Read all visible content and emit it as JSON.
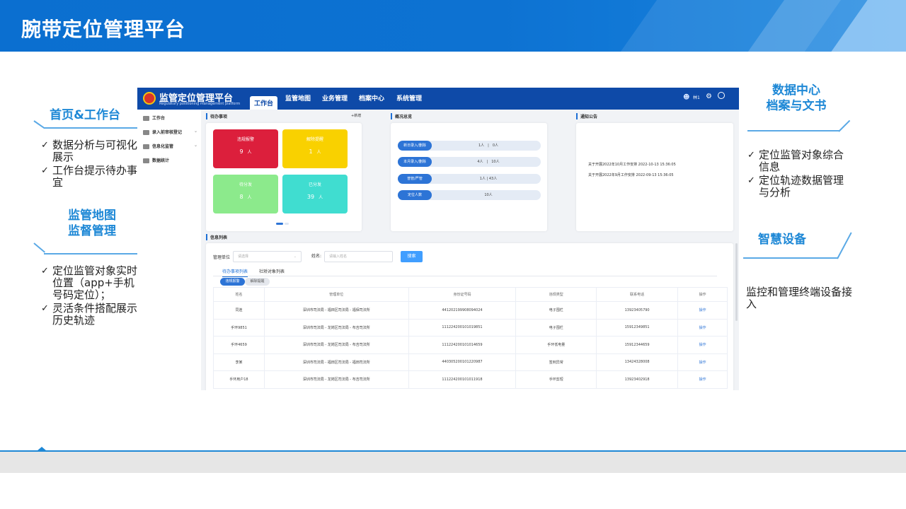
{
  "slide": {
    "title": "腕带定位管理平台"
  },
  "captions": {
    "home": {
      "title": "首页&工作台",
      "items": [
        "数据分析与可视化展示",
        "工作台提示待办事宜"
      ]
    },
    "map": {
      "title_line1": "监管地图",
      "title_line2": "监督管理",
      "items": [
        "定位监管对象实时位置（app+手机号码定位）；",
        "灵活条件搭配展示历史轨迹"
      ]
    },
    "data": {
      "title_line1": "数据中心",
      "title_line2": "档案与文书",
      "items": [
        "定位监管对象综合信息",
        "定位轨迹数据管理与分析"
      ]
    },
    "device": {
      "title": "智慧设备",
      "text": "监控和管理终端设备接入"
    }
  },
  "app": {
    "name": "监管定位管理平台",
    "subtitle": "Regulatory positioning management platform",
    "nav_tabs": [
      "工作台",
      "监管地图",
      "业务管理",
      "档案中心",
      "系统管理"
    ],
    "active_tab": "工作台",
    "user": "林1",
    "sidebar": [
      {
        "label": "工作台"
      },
      {
        "label": "录入前审核登记"
      },
      {
        "label": "信息化监管"
      },
      {
        "label": "数据统计"
      }
    ],
    "todo": {
      "title": "待办事项",
      "add": "+新增",
      "tiles": [
        {
          "label": "违规报警",
          "value": "9",
          "unit": "人",
          "color": "#dc1f3c"
        },
        {
          "label": "解除提醒",
          "value": "1",
          "unit": "人",
          "color": "#f9d100"
        },
        {
          "label": "待分发",
          "value": "8",
          "unit": "人",
          "color": "#8cea8c"
        },
        {
          "label": "已分发",
          "value": "39",
          "unit": "人",
          "color": "#40ddd0"
        }
      ]
    },
    "overview": {
      "title": "概况总览",
      "rows": [
        {
          "label": "新日录入/删除",
          "value": "1人　|　0人"
        },
        {
          "label": "本月录入/删除",
          "value": "4人　|　10人"
        },
        {
          "label": "普管/严管",
          "value": "1人 | 43人"
        },
        {
          "label": "定位人数",
          "value": "10人"
        }
      ]
    },
    "notice": {
      "title": "通知公告",
      "items": [
        "关于开展2022年10月工作安排 2022-10-13 15:36:05",
        "关于开展2022年9月工作安排 2022-09-13 15:36:05"
      ]
    },
    "info": {
      "title": "信息列表",
      "unit_label": "管理单位",
      "unit_placeholder": "请选择",
      "name_label": "姓名:",
      "name_placeholder": "请输入姓名",
      "search": "搜索",
      "subtabs": [
        "待办事项列表",
        "社矫对象列表"
      ],
      "pills": [
        "违规报警",
        "解除提醒"
      ],
      "columns": [
        "姓名",
        "管理单位",
        "身份证号码",
        "违规类型",
        "联系电话",
        "操作"
      ],
      "rows": [
        [
          "同连",
          "深圳市司法局 - 福田区司法局 - 福保司法所",
          "441202199908094024",
          "电子围栏",
          "13923405790",
          "操作"
        ],
        [
          "手环9851",
          "深圳市司法局 - 龙岗区司法局 - 布吉司法所",
          "111224200101019851",
          "电子围栏",
          "15912349851",
          "操作"
        ],
        [
          "手环4659",
          "深圳市司法局 - 龙岗区司法局 - 布吉司法所",
          "111224200101014659",
          "手环低电量",
          "15912344659",
          "操作"
        ],
        [
          "李某",
          "深圳市司法局 - 福田区司法局 - 福田司法所",
          "440305200101220987",
          "签到异常",
          "13424328008",
          "操作"
        ],
        [
          "手环用户18",
          "深圳市司法局 - 龙岗区司法局 - 布吉司法所",
          "111224200101011918",
          "手环剪短",
          "13923402918",
          "操作"
        ]
      ]
    }
  }
}
